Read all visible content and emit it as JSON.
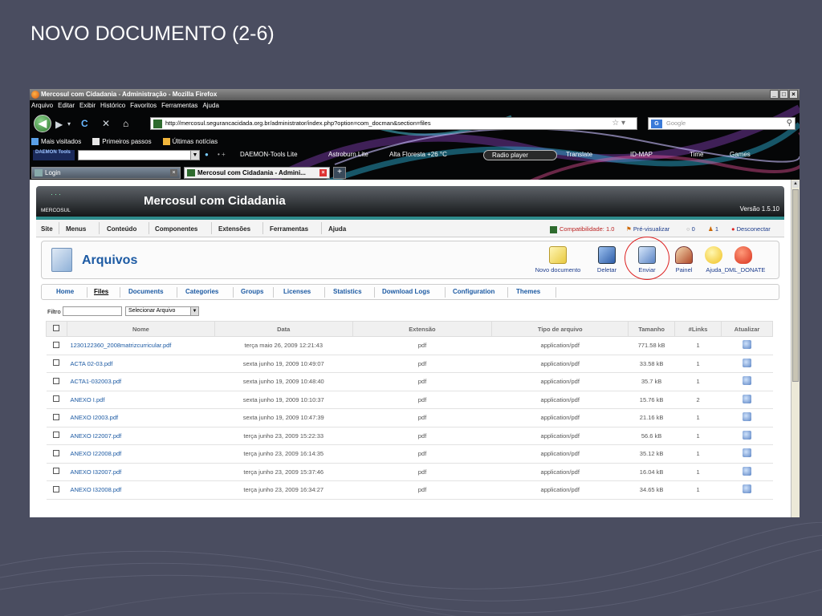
{
  "slide_title": "NOVO DOCUMENTO (2-6)",
  "window": {
    "title": "Mercosul com Cidadania - Administração - Mozilla Firefox",
    "buttons": [
      "_",
      "×"
    ]
  },
  "browser": {
    "menu": [
      "Arquivo",
      "Editar",
      "Exibir",
      "Histórico",
      "Favoritos",
      "Ferramentas",
      "Ajuda"
    ],
    "url": "http://mercosul.segurancacidada.org.br/administrator/index.php?option=com_docman&section=files",
    "search_placeholder": "Google",
    "bookmarks": [
      "Mais visitados",
      "Primeiros passos",
      "Últimas notícias"
    ],
    "toolbar_logo": "DAEMON Tools",
    "toolbar_items": [
      "DAEMON-Tools Lite",
      "Astroburn Lite",
      "Alta Floresta +26 °C",
      "Radio player",
      "Translate",
      "ID-MAP",
      "Time",
      "Games"
    ],
    "tabs": [
      {
        "label": "Login",
        "active": false
      },
      {
        "label": "Mercosul com Cidadania - Admini...",
        "active": true
      }
    ]
  },
  "joomla": {
    "logo_text": "MERCOSUL",
    "site_name": "Mercosul com Cidadania",
    "version": "Versão 1.5.10",
    "menu": [
      "Site",
      "Menus",
      "Conteúdo",
      "Componentes",
      "Extensões",
      "Ferramentas",
      "Ajuda"
    ],
    "status": {
      "compat": "Compatibilidade: 1.0",
      "preview": "Pré-visualizar",
      "messages": "0",
      "users": "1",
      "logout": "Desconectar"
    },
    "page_title": "Arquivos",
    "toolbar": [
      "Novo documento",
      "Deletar",
      "Enviar",
      "Painel",
      "Ajuda",
      "_DML_DONATE"
    ],
    "submenu": [
      "Home",
      "Files",
      "Documents",
      "Categories",
      "Groups",
      "Licenses",
      "Statistics",
      "Download Logs",
      "Configuration",
      "Themes"
    ],
    "active_submenu": "Files",
    "filter": {
      "label": "Filtro",
      "value": "",
      "select": "Selecionar Arquivo"
    },
    "table": {
      "headers": [
        "Nome",
        "Data",
        "Extensão",
        "Tipo de arquivo",
        "Tamanho",
        "#Links",
        "Atualizar"
      ],
      "rows": [
        {
          "name": "1230122360_2008matrizcurricular.pdf",
          "date": "terça maio 26, 2009 12:21:43",
          "ext": "pdf",
          "type": "application/pdf",
          "size": "771.58 kB",
          "links": "1"
        },
        {
          "name": "ACTA 02-03.pdf",
          "date": "sexta junho 19, 2009 10:49:07",
          "ext": "pdf",
          "type": "application/pdf",
          "size": "33.58 kB",
          "links": "1"
        },
        {
          "name": "ACTA1-032003.pdf",
          "date": "sexta junho 19, 2009 10:48:40",
          "ext": "pdf",
          "type": "application/pdf",
          "size": "35.7 kB",
          "links": "1"
        },
        {
          "name": "ANEXO I.pdf",
          "date": "sexta junho 19, 2009 10:10:37",
          "ext": "pdf",
          "type": "application/pdf",
          "size": "15.76 kB",
          "links": "2"
        },
        {
          "name": "ANEXO I2003.pdf",
          "date": "sexta junho 19, 2009 10:47:39",
          "ext": "pdf",
          "type": "application/pdf",
          "size": "21.16 kB",
          "links": "1"
        },
        {
          "name": "ANEXO I22007.pdf",
          "date": "terça junho 23, 2009 15:22:33",
          "ext": "pdf",
          "type": "application/pdf",
          "size": "56.6 kB",
          "links": "1"
        },
        {
          "name": "ANEXO I22008.pdf",
          "date": "terça junho 23, 2009 16:14:35",
          "ext": "pdf",
          "type": "application/pdf",
          "size": "35.12 kB",
          "links": "1"
        },
        {
          "name": "ANEXO I32007.pdf",
          "date": "terça junho 23, 2009 15:37:46",
          "ext": "pdf",
          "type": "application/pdf",
          "size": "16.04 kB",
          "links": "1"
        },
        {
          "name": "ANEXO I32008.pdf",
          "date": "terça junho 23, 2009 16:34:27",
          "ext": "pdf",
          "type": "application/pdf",
          "size": "34.65 kB",
          "links": "1"
        }
      ]
    }
  },
  "colors": {
    "slide_bg": "#4a4d60",
    "joomla_blue": "#1c5aa3",
    "highlight_ring": "#dd2222"
  },
  "icons": [
    "firefox-icon",
    "back-icon",
    "forward-icon",
    "reload-icon",
    "stop-icon",
    "home-icon",
    "bookmark-star-icon",
    "search-icon",
    "new-document-icon",
    "delete-icon",
    "upload-icon",
    "dashboard-icon",
    "help-icon",
    "donate-icon",
    "refresh-icon"
  ]
}
